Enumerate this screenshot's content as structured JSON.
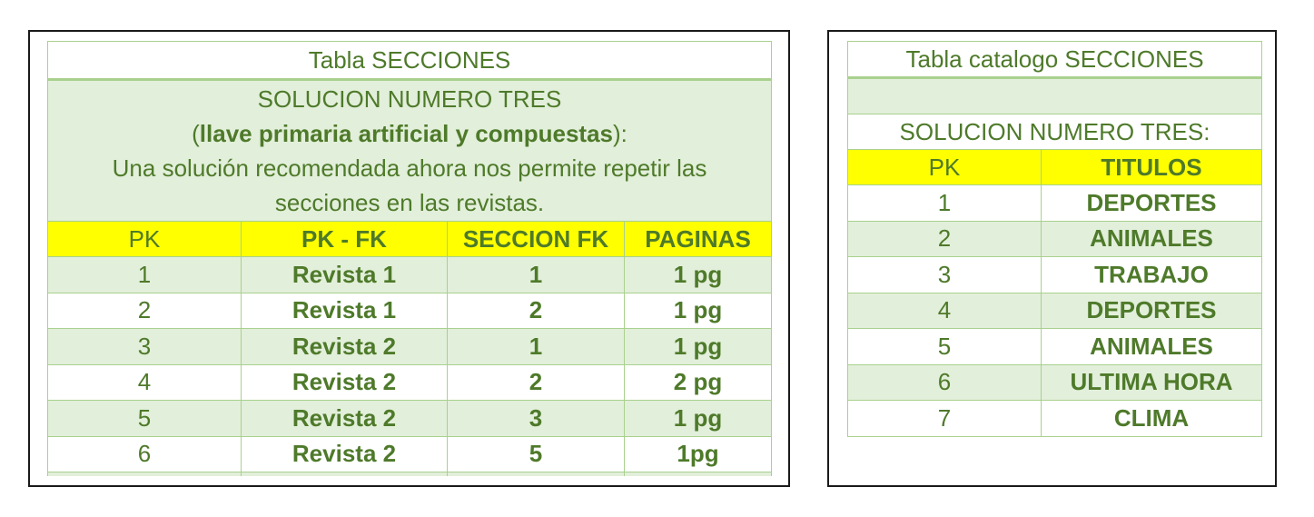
{
  "left_table": {
    "title": "Tabla SECCIONES",
    "desc": {
      "line1": "SOLUCION NUMERO TRES",
      "line2_open": "(",
      "line2_bold": "llave primaria artificial y compuestas",
      "line2_close": "):",
      "line3": "Una solución recomendada ahora nos permite repetir las secciones en las revistas."
    },
    "headers": [
      "PK",
      "PK - FK",
      "SECCION FK",
      "PAGINAS"
    ],
    "rows": [
      [
        "1",
        "Revista 1",
        "1",
        "1 pg"
      ],
      [
        "2",
        "Revista 1",
        "2",
        "1 pg"
      ],
      [
        "3",
        "Revista 2",
        "1",
        "1 pg"
      ],
      [
        "4",
        "Revista 2",
        "2",
        "2 pg"
      ],
      [
        "5",
        "Revista 2",
        "3",
        "1 pg"
      ],
      [
        "6",
        "Revista 2",
        "5",
        "1pg"
      ]
    ]
  },
  "right_table": {
    "title": "Tabla  catalogo SECCIONES",
    "subtitle": "SOLUCION NUMERO TRES:",
    "headers": [
      "PK",
      "TITULOS"
    ],
    "rows": [
      [
        "1",
        "DEPORTES"
      ],
      [
        "2",
        "ANIMALES"
      ],
      [
        "3",
        "TRABAJO"
      ],
      [
        "4",
        "DEPORTES"
      ],
      [
        "5",
        "ANIMALES"
      ],
      [
        "6",
        "ULTIMA HORA"
      ],
      [
        "7",
        "CLIMA"
      ]
    ]
  },
  "colors": {
    "text_green": "#4e7a2a",
    "band_green": "#e2efda",
    "border_green": "#a9d18e",
    "header_yellow": "#ffff00"
  }
}
